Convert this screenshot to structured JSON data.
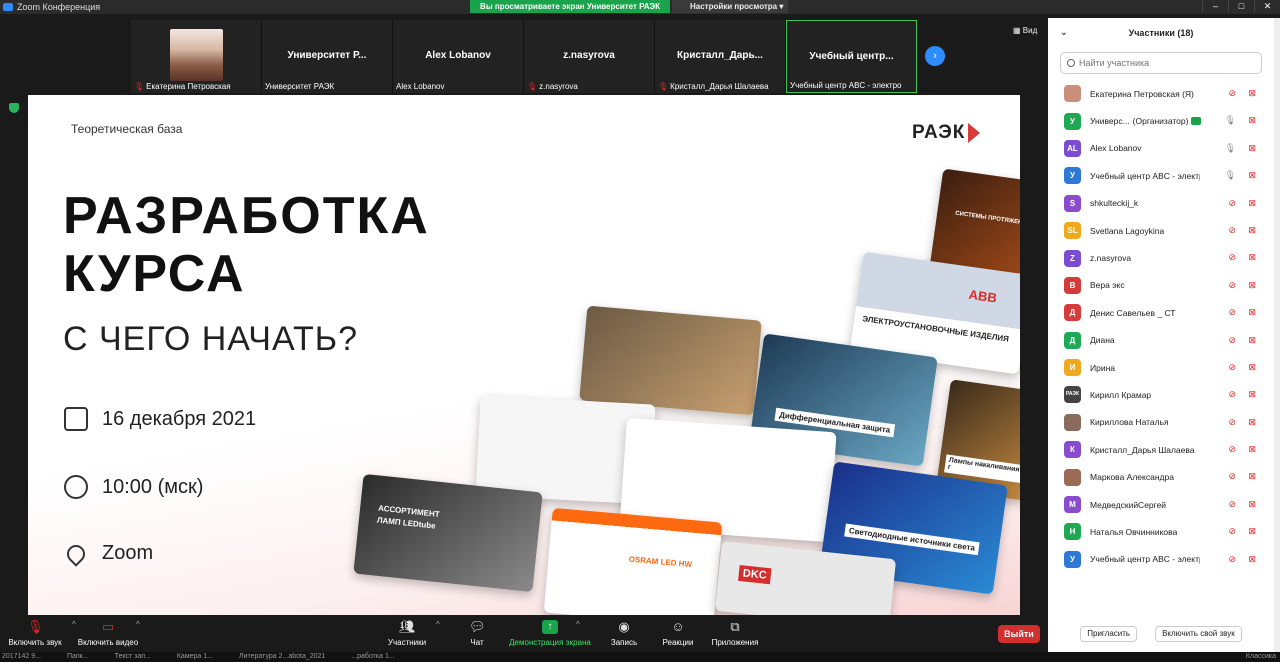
{
  "window": {
    "title": "Zoom Конференция",
    "share_banner": "Вы просматриваете экран Университет РАЭК",
    "view_settings": "Настройки просмотра",
    "view_toggle": "Вид"
  },
  "thumbnails": [
    {
      "name": "",
      "label": "Екатерина Петровская",
      "mic_muted": true,
      "has_photo": true
    },
    {
      "name": "Университет Р...",
      "label": "Университет РАЭК",
      "mic_muted": false
    },
    {
      "name": "Alex Lobanov",
      "label": "Alex Lobanov",
      "mic_muted": false
    },
    {
      "name": "z.nasyrova",
      "label": "z.nasyrova",
      "mic_muted": true
    },
    {
      "name": "Кристалл_Дарь...",
      "label": "Кристалл_Дарья Шалаева",
      "mic_muted": true
    },
    {
      "name": "Учебный центр...",
      "label": "Учебный центр ABC - электро",
      "mic_muted": false,
      "active": true
    }
  ],
  "slide": {
    "tag": "Теоретическая база",
    "brand": "РАЭК",
    "headline_1": "РАЗРАБОТКА",
    "headline_2": "КУРСА",
    "subhead": "С ЧЕГО НАЧАТЬ?",
    "date": "16 декабря 2021",
    "time": "10:00 (мск)",
    "place": "Zoom",
    "cards": {
      "abb": "ЭЛЕКТРОУСТАНОВОЧНЫЕ ИЗДЕЛИЯ",
      "abb_logo": "ABB",
      "diff": "Дифференциальная защита",
      "lamps": "Лампы накаливания и г",
      "led_tube_1": "АССОРТИМЕНТ",
      "led_tube_2": "ЛАМП LEDtube",
      "osram": "OSRAM LED HW",
      "led_sources": "Светодиодные источники света",
      "dkc": "DKC",
      "systems": "СИСТЕМЫ ПРОТЯЖЕННЫЕ"
    }
  },
  "toolbar": {
    "mute": "Включить звук",
    "video": "Включить видео",
    "participants": "Участники",
    "participants_count": "18",
    "chat": "Чат",
    "share": "Демонстрация экрана",
    "record": "Запись",
    "reactions": "Реакции",
    "apps": "Приложения",
    "leave": "Выйти"
  },
  "panel": {
    "title": "Участники (18)",
    "search_placeholder": "Найти участника",
    "invite": "Пригласить",
    "unmute_me": "Включить свой звук",
    "participants": [
      {
        "initials": "",
        "name": "Екатерина Петровская (Я)",
        "color": "#c98f7a",
        "mic": "muted",
        "photo": true
      },
      {
        "initials": "У",
        "name": "Универс...",
        "suffix": "(Организатор)",
        "color": "#1eaa55",
        "mic": "on",
        "host": true
      },
      {
        "initials": "AL",
        "name": "Alex Lobanov",
        "color": "#7b4ccf",
        "mic": "on"
      },
      {
        "initials": "У",
        "name": "Учебный центр ABC - электро",
        "color": "#2d78d8",
        "mic": "on"
      },
      {
        "initials": "S",
        "name": "shkulteckij_k",
        "color": "#8a4ccf",
        "mic": "muted"
      },
      {
        "initials": "SL",
        "name": "Svetlana Lagoykina",
        "color": "#f0a81c",
        "mic": "muted"
      },
      {
        "initials": "Z",
        "name": "z.nasyrova",
        "color": "#7b4ccf",
        "mic": "muted"
      },
      {
        "initials": "В",
        "name": "Вера экс",
        "color": "#d63b3b",
        "mic": "muted"
      },
      {
        "initials": "Д",
        "name": "Денис Савельев _ СТ",
        "color": "#d63b3b",
        "mic": "muted"
      },
      {
        "initials": "Д",
        "name": "Диана",
        "color": "#1eaa55",
        "mic": "muted"
      },
      {
        "initials": "И",
        "name": "Ирина",
        "color": "#f0a81c",
        "mic": "muted"
      },
      {
        "initials": "РАЭК",
        "name": "Кирилл Крамар",
        "color": "#444444",
        "mic": "muted"
      },
      {
        "initials": "",
        "name": "Кириллова Наталья",
        "color": "#8a6a5a",
        "mic": "muted",
        "photo": true
      },
      {
        "initials": "К",
        "name": "Кристалл_Дарья Шалаева",
        "color": "#8a4ccf",
        "mic": "muted"
      },
      {
        "initials": "",
        "name": "Маркова Александра",
        "color": "#9a6a55",
        "mic": "muted",
        "photo": true
      },
      {
        "initials": "М",
        "name": "МедведскийСергей",
        "color": "#8a4ccf",
        "mic": "muted"
      },
      {
        "initials": "Н",
        "name": "Наталья Овчинникова",
        "color": "#1eaa55",
        "mic": "muted"
      },
      {
        "initials": "У",
        "name": "Учебный центр ABC - электро",
        "color": "#2d78d8",
        "mic": "muted"
      }
    ]
  },
  "taskbar": {
    "items": [
      "2017142 9...",
      "Папк...",
      "Текст зап...",
      "Камера 1...",
      "Литература 2...abota_2021",
      "...работка 1..."
    ],
    "right": "Классика"
  }
}
